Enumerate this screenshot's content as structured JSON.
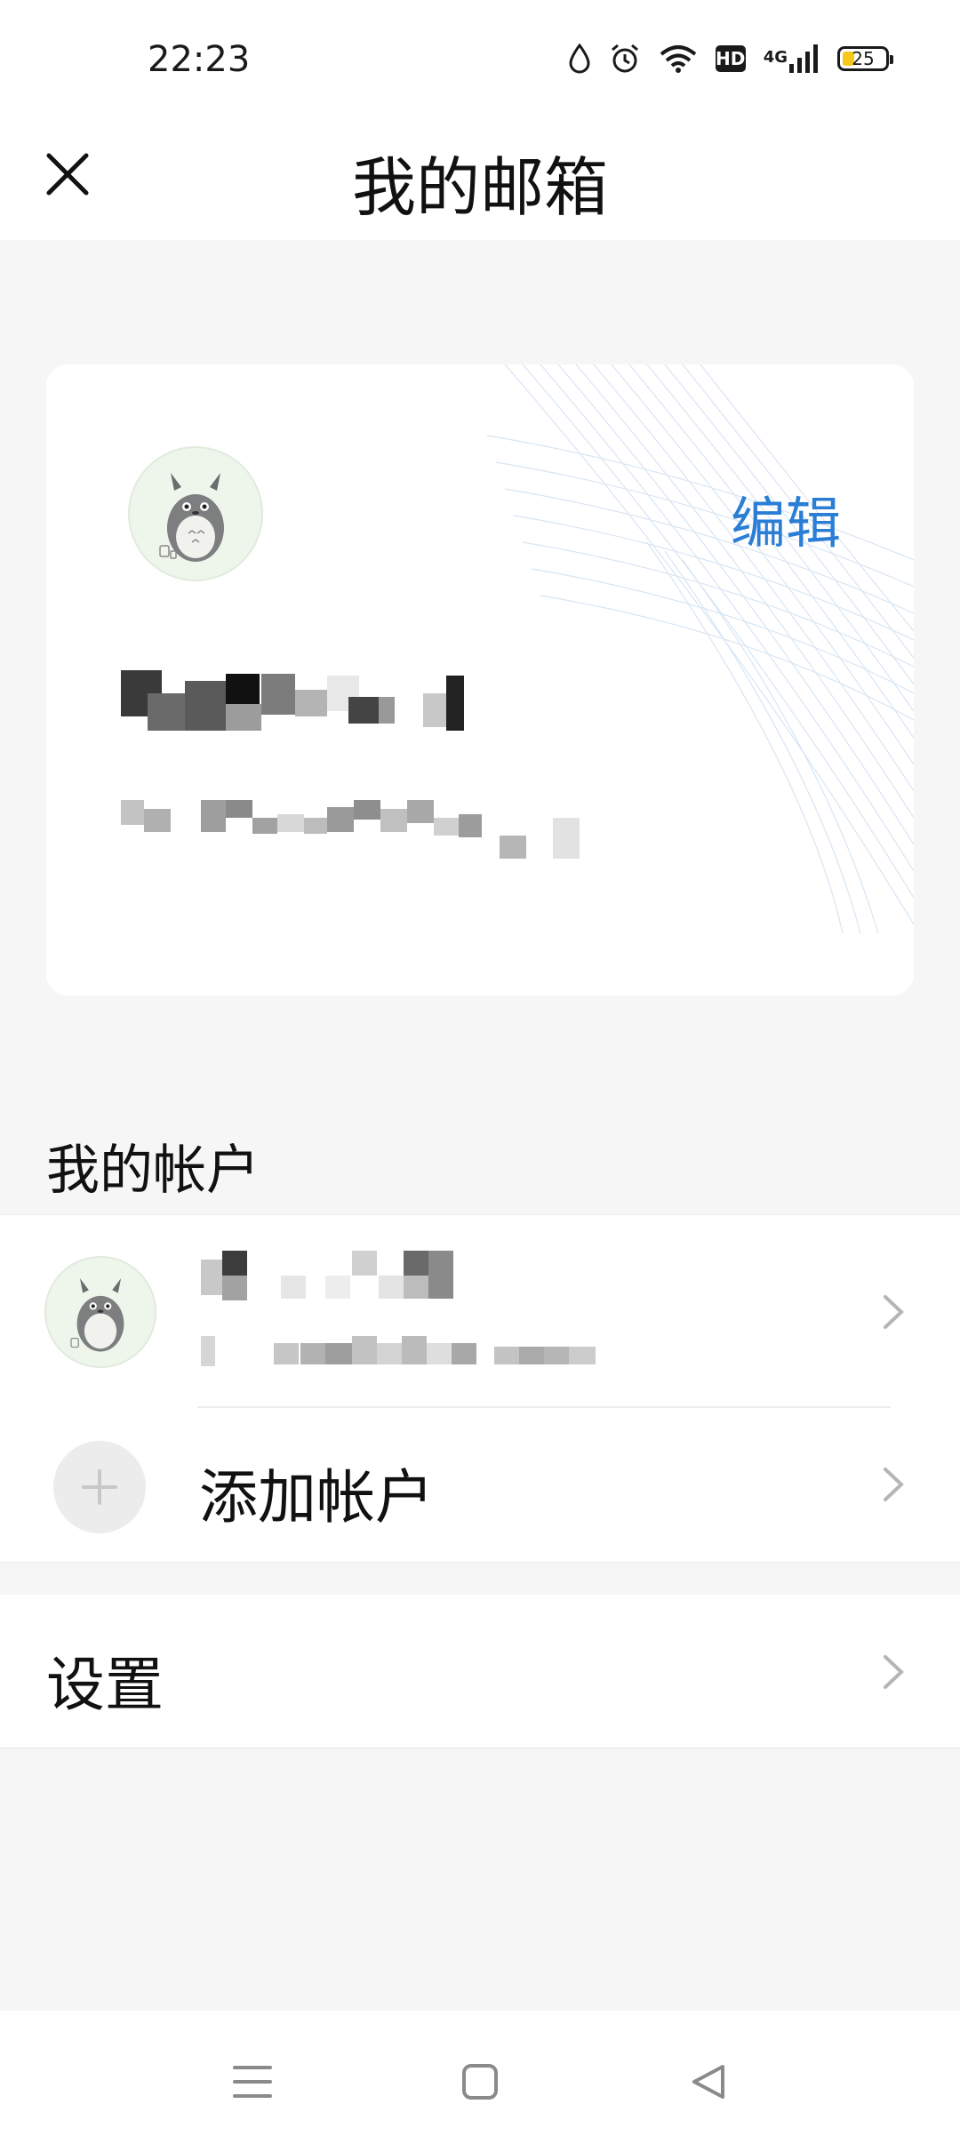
{
  "status_bar": {
    "time": "22:23",
    "hd_label": "HD",
    "network_label": "4G",
    "battery_level": "25",
    "icons": [
      "water-drop-icon",
      "alarm-clock-icon",
      "wifi-icon",
      "hd-icon",
      "signal-icon",
      "battery-icon"
    ]
  },
  "header": {
    "title": "我的邮箱",
    "close_icon": "close-icon"
  },
  "profile_card": {
    "edit_label": "编辑",
    "avatar_icon": "totoro-avatar"
  },
  "accounts_section": {
    "title": "我的帐户",
    "add_account_label": "添加帐户"
  },
  "settings_row": {
    "label": "设置"
  },
  "nav_bar": {
    "icons": [
      "menu-icon",
      "home-square-icon",
      "back-triangle-icon"
    ]
  },
  "colors": {
    "accent": "#2a7ed6",
    "background": "#f6f6f6",
    "card": "#ffffff",
    "text": "#111111",
    "chevron": "#b5b5b5"
  }
}
